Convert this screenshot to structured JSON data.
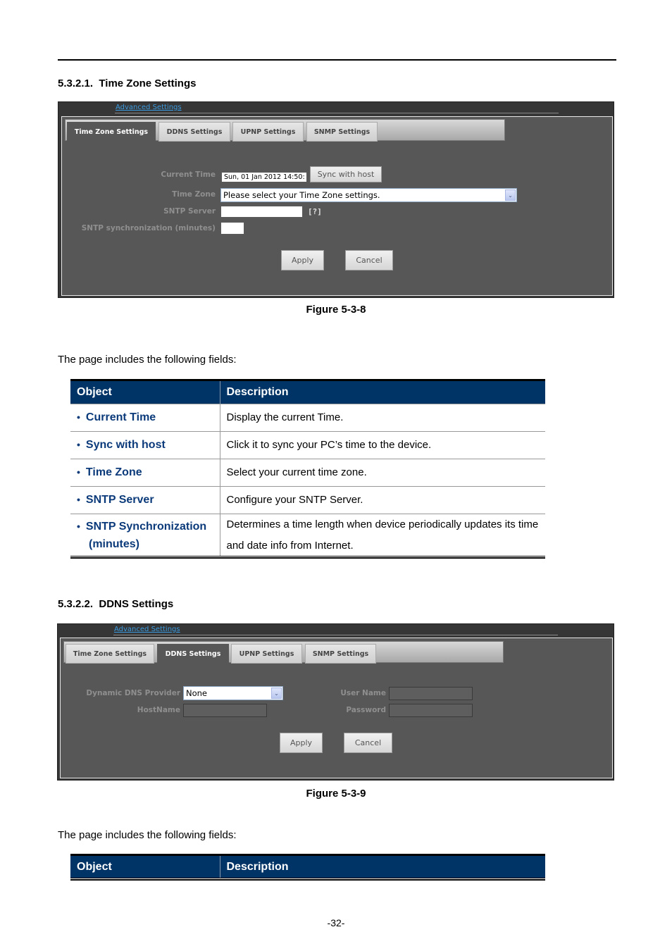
{
  "page": {
    "number": "-32-",
    "intro_text": "The page includes the following fields:"
  },
  "sections": [
    {
      "heading_number": "5.3.2.1.",
      "heading_title": "Time Zone Settings",
      "figure_caption": "Figure 5-3-8"
    },
    {
      "heading_number": "5.3.2.2.",
      "heading_title": "DDNS Settings",
      "figure_caption": "Figure 5-3-9"
    }
  ],
  "ui": {
    "breadcrumb": "Advanced Settings",
    "tabs": [
      "Time Zone Settings",
      "DDNS Settings",
      "UPNP Settings",
      "SNMP Settings"
    ],
    "apply_label": "Apply",
    "cancel_label": "Cancel",
    "timezone": {
      "active_tab": "Time Zone Settings",
      "current_time_label": "Current Time",
      "current_time_value": "Sun, 01 Jan 2012 14:50:",
      "sync_button": "Sync with host",
      "time_zone_label": "Time Zone",
      "time_zone_value": "Please select your Time Zone settings.",
      "sntp_server_label": "SNTP Server",
      "sntp_server_value": "",
      "sntp_help": "[?]",
      "sntp_sync_label": "SNTP synchronization (minutes)",
      "sntp_sync_value": ""
    },
    "ddns": {
      "active_tab": "DDNS Settings",
      "provider_label": "Dynamic DNS Provider",
      "provider_value": "None",
      "hostname_label": "HostName",
      "hostname_value": "",
      "username_label": "User Name",
      "username_value": "",
      "password_label": "Password",
      "password_value": ""
    }
  },
  "tables": [
    {
      "headers": [
        "Object",
        "Description"
      ],
      "rows": [
        {
          "object": "Current Time",
          "description": "Display the current Time."
        },
        {
          "object": "Sync with host",
          "description": "Click it to sync your PC’s time to the device."
        },
        {
          "object": "Time Zone",
          "description": "Select your current time zone."
        },
        {
          "object": "SNTP Server",
          "description": "Configure your SNTP Server."
        },
        {
          "object": "SNTP Synchronization (minutes)",
          "description": "Determines a time length when device periodically updates its time and date info from Internet."
        }
      ]
    },
    {
      "headers": [
        "Object",
        "Description"
      ],
      "rows": []
    }
  ]
}
